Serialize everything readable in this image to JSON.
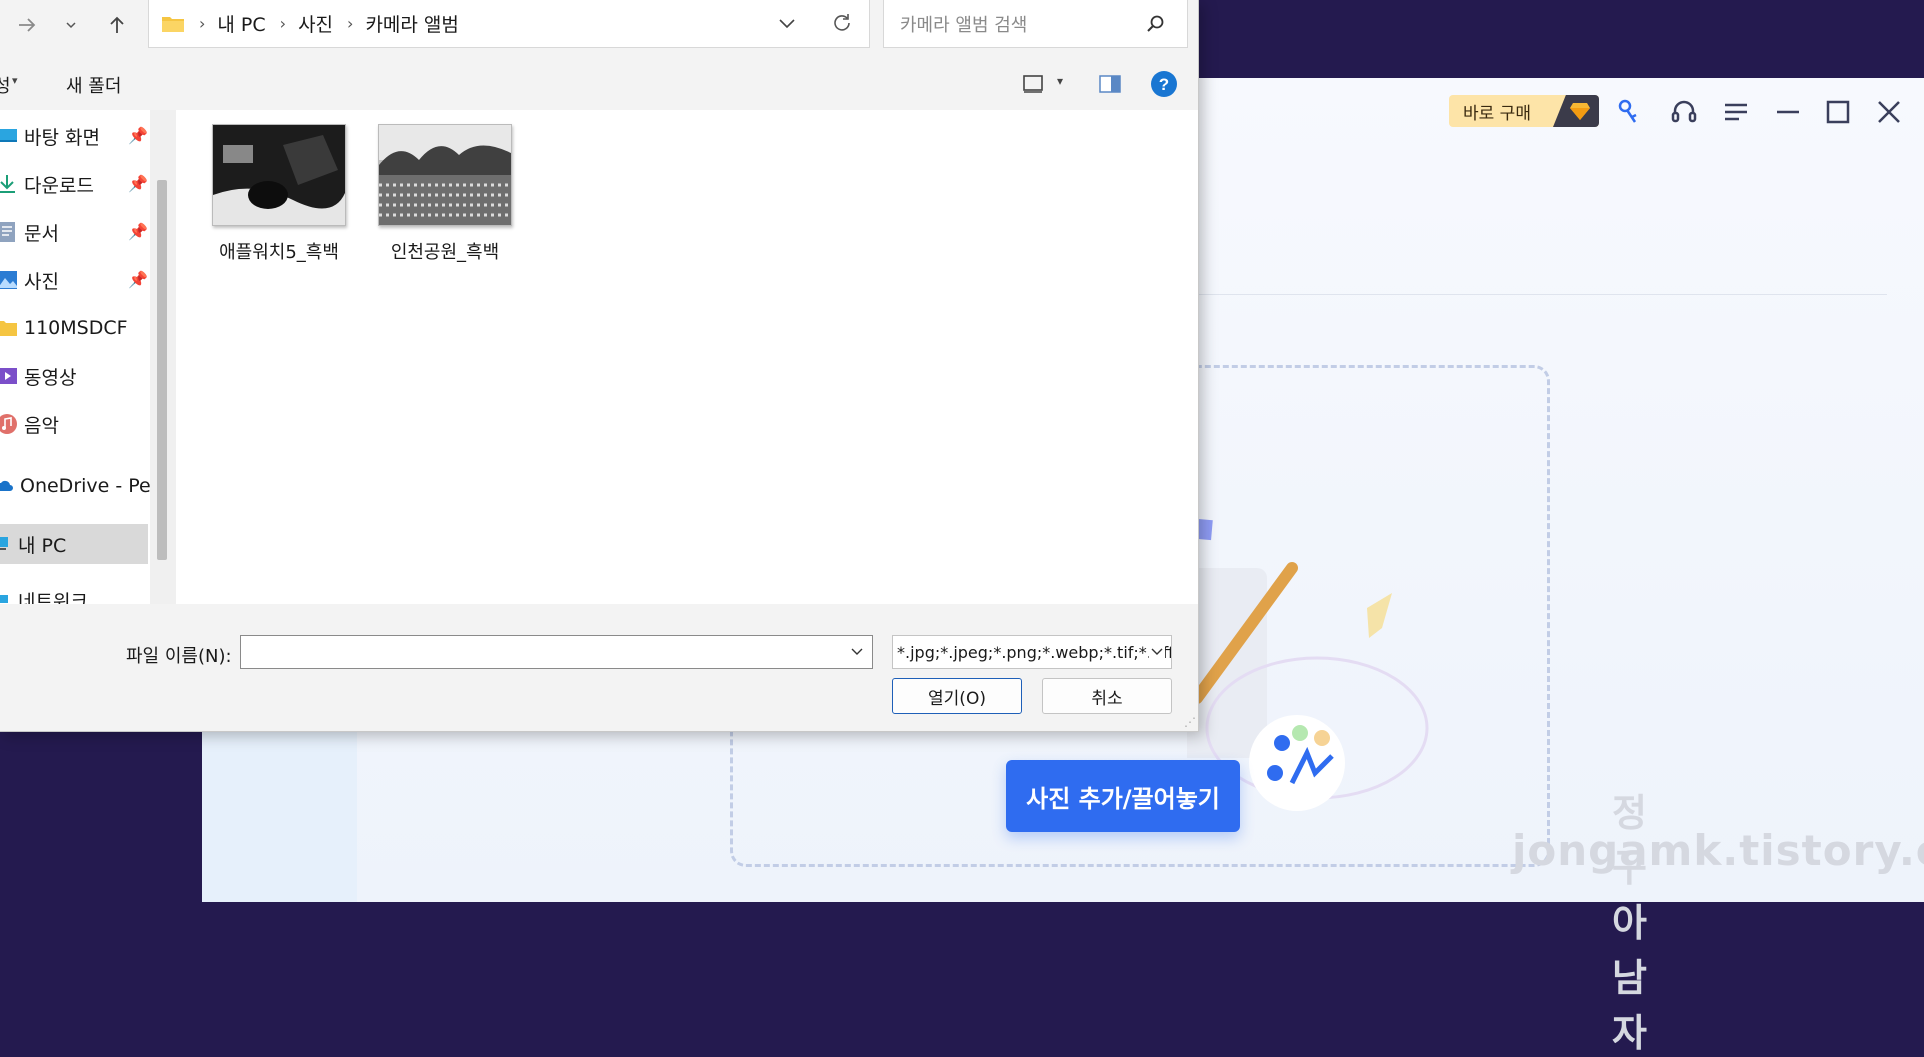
{
  "app": {
    "buy_label": "바로 구매",
    "add_button": "사진 추가/끌어놓기",
    "watermark_line1": "정구아 남자",
    "watermark_line2": "jongamk.tistory.com",
    "icons": [
      "key-icon",
      "headset-icon",
      "menu-icon",
      "minimize-icon",
      "maximize-icon",
      "close-icon"
    ],
    "accent": "#2f6cf0"
  },
  "dialog": {
    "breadcrumbs": [
      "내 PC",
      "사진",
      "카메라 앨범"
    ],
    "search_placeholder": "카메라 앨범 검색",
    "toolbar": {
      "left_cut": "성",
      "new_folder": "새 폴더"
    },
    "nav_items": [
      {
        "label": "바탕 화면",
        "icon": "desktop-icon",
        "pinned": true
      },
      {
        "label": "다운로드",
        "icon": "download-icon",
        "pinned": true
      },
      {
        "label": "문서",
        "icon": "document-icon",
        "pinned": true
      },
      {
        "label": "사진",
        "icon": "pictures-icon",
        "pinned": true
      },
      {
        "label": "110MSDCF",
        "icon": "folder-icon",
        "pinned": false
      },
      {
        "label": "동영상",
        "icon": "video-icon",
        "pinned": false
      },
      {
        "label": "음악",
        "icon": "music-icon",
        "pinned": false
      },
      {
        "label": "OneDrive - Perso",
        "icon": "cloud-icon",
        "pinned": false
      },
      {
        "label": "내 PC",
        "icon": "pc-icon",
        "pinned": false,
        "selected": true
      },
      {
        "label": "네트워크",
        "icon": "network-icon",
        "pinned": false
      }
    ],
    "files": [
      {
        "name": "애플워치5_흑백"
      },
      {
        "name": "인천공원_흑백"
      }
    ],
    "filename_label": "파일 이름(N):",
    "filename_value": "",
    "filter": "*.jpg;*.jpeg;*.png;*.webp;*.tif;*.tiff",
    "open_label": "열기(O)",
    "cancel_label": "취소"
  }
}
